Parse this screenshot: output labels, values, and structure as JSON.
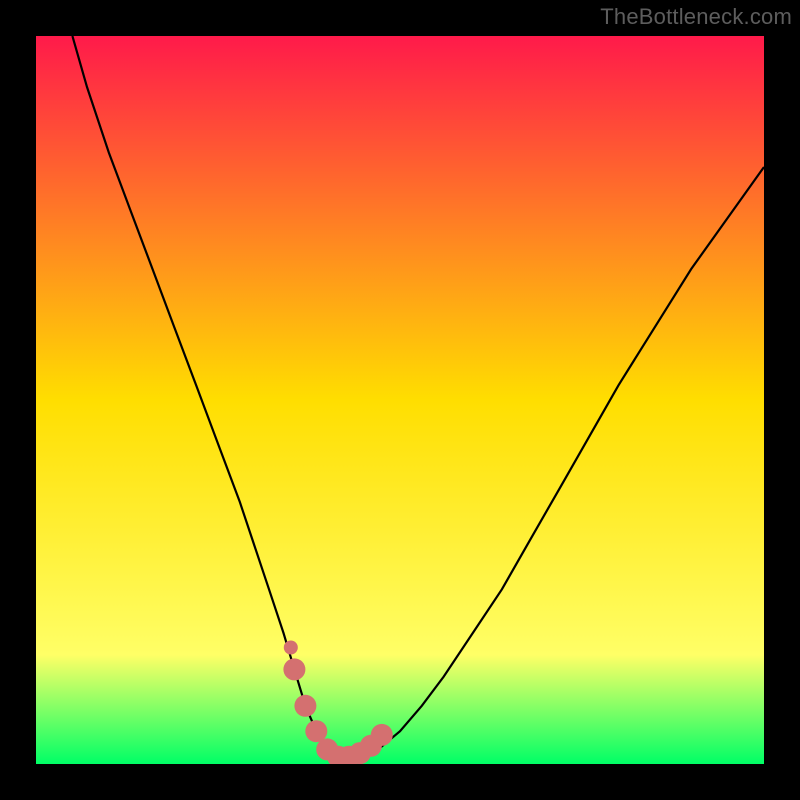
{
  "watermark": "TheBottleneck.com",
  "colors": {
    "frame": "#000000",
    "gradient_top": "#ff1a4a",
    "gradient_mid": "#ffde00",
    "gradient_low": "#ffff66",
    "gradient_bottom": "#00ff66",
    "curve": "#000000",
    "marker": "#d47070"
  },
  "chart_data": {
    "type": "line",
    "title": "",
    "xlabel": "",
    "ylabel": "",
    "xlim": [
      0,
      100
    ],
    "ylim": [
      0,
      100
    ],
    "series": [
      {
        "name": "bottleneck-curve",
        "x": [
          5,
          7,
          10,
          13,
          16,
          19,
          22,
          25,
          28,
          30,
          32,
          34,
          35.5,
          37,
          38.5,
          40,
          42,
          44,
          47,
          50,
          53,
          56,
          60,
          64,
          68,
          72,
          76,
          80,
          85,
          90,
          95,
          100
        ],
        "y": [
          100,
          93,
          84,
          76,
          68,
          60,
          52,
          44,
          36,
          30,
          24,
          18,
          13,
          8,
          4.5,
          2,
          1,
          1,
          2,
          4.5,
          8,
          12,
          18,
          24,
          31,
          38,
          45,
          52,
          60,
          68,
          75,
          82
        ]
      }
    ],
    "markers": {
      "name": "highlight-dots",
      "x": [
        35.5,
        37,
        38.5,
        40,
        41.5,
        43,
        44.5,
        46,
        47.5
      ],
      "y": [
        13,
        8,
        4.5,
        2,
        1,
        1,
        1.5,
        2.5,
        4
      ]
    },
    "extra_marker": {
      "x": 35,
      "y": 16
    }
  }
}
